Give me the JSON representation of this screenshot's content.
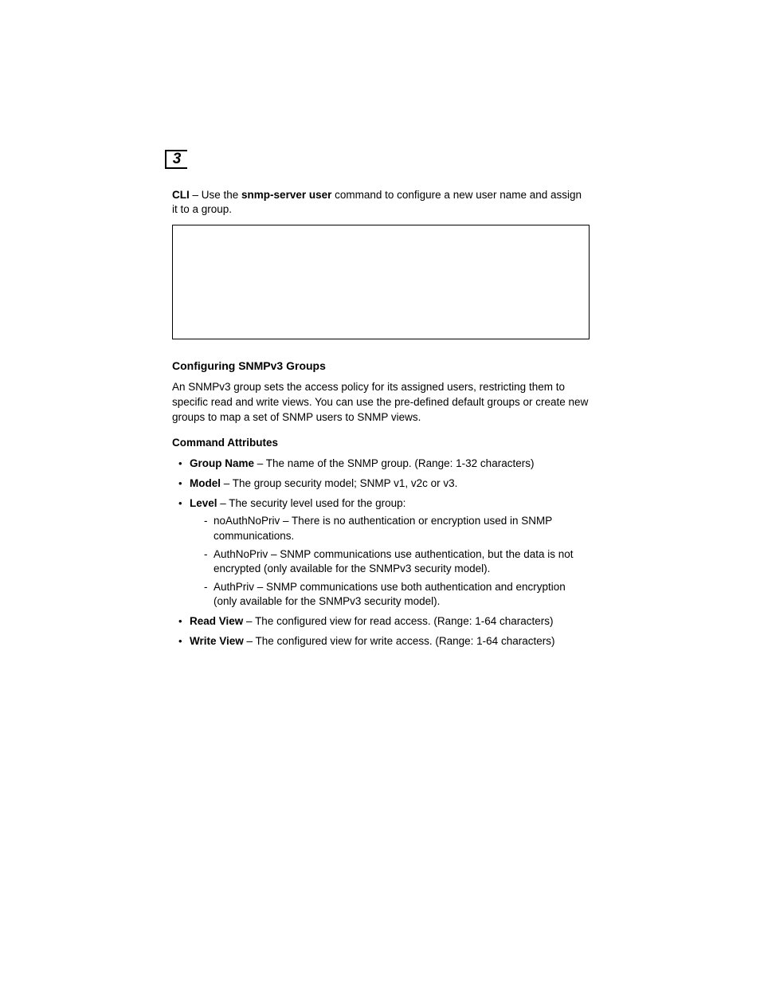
{
  "page_number": "3",
  "intro": {
    "prefix_bold": "CLI",
    "mid1": " – Use the ",
    "cmd_bold": "snmp-server user",
    "mid2": " command to configure a new user name and assign it to a group."
  },
  "section": {
    "heading": "Configuring SNMPv3 Groups",
    "paragraph": "An SNMPv3 group sets the access policy for its assigned users, restricting them to specific read and write views. You can use the pre-defined default groups or create new groups to map a set of SNMP users to SNMP views."
  },
  "attributes": {
    "heading": "Command Attributes",
    "items": [
      {
        "label": "Group Name",
        "text": " – The name of the SNMP group. (Range: 1-32 characters)"
      },
      {
        "label": "Model",
        "text": " – The group security model; SNMP v1, v2c or v3."
      },
      {
        "label": "Level",
        "text": " – The security level used for the group:",
        "sub": [
          "noAuthNoPriv – There is no authentication or encryption used in SNMP communications.",
          "AuthNoPriv – SNMP communications use authentication, but the data is not encrypted (only available for the SNMPv3 security model).",
          "AuthPriv – SNMP communications use both authentication and encryption (only available for the SNMPv3 security model)."
        ]
      },
      {
        "label": "Read View",
        "text": " – The configured view for read access. (Range: 1-64 characters)"
      },
      {
        "label": "Write View",
        "text": " – The configured view for write access. (Range: 1-64 characters)"
      }
    ]
  }
}
